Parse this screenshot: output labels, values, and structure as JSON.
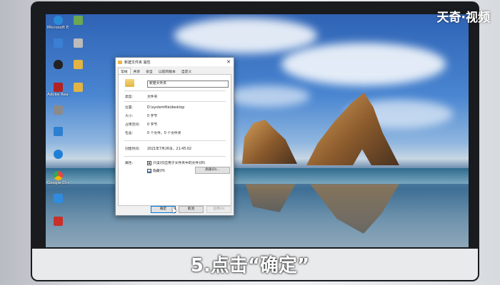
{
  "watermark": "天奇·视频",
  "caption": "5.点击“确定”",
  "desktop_icons": [
    {
      "label": "Microsoft Edge",
      "icon": "edge-icon",
      "color": "#2a8ad8"
    },
    {
      "label": "",
      "icon": "file-icon",
      "color": "#6ba84f"
    },
    {
      "label": "",
      "icon": "app-icon",
      "color": "#3b7fd4"
    },
    {
      "label": "",
      "icon": "app-icon",
      "color": "#bbbbbb"
    },
    {
      "label": "",
      "icon": "penguin-icon",
      "color": "#222222"
    },
    {
      "label": "",
      "icon": "folder-icon",
      "color": "#e3b443"
    },
    {
      "label": "",
      "icon": "app-icon",
      "color": "#3c73c7"
    },
    {
      "label": "",
      "icon": "app-icon",
      "color": "#d04a3a"
    },
    {
      "label": "Adobe Reader",
      "icon": "pdf-icon",
      "color": "#b22222"
    },
    {
      "label": "",
      "icon": "folder-icon",
      "color": "#e3b443"
    },
    {
      "label": "",
      "icon": "app-icon",
      "color": "#8a8a8a"
    },
    {
      "label": "",
      "icon": "app-icon",
      "color": "#2c7fd1"
    },
    {
      "label": "",
      "icon": "app-icon",
      "color": "#1f7fd8"
    },
    {
      "label": "Google Chrome",
      "icon": "chrome-icon",
      "color": "#e8453c"
    },
    {
      "label": "",
      "icon": "app-icon",
      "color": "#2f8ce0"
    },
    {
      "label": "",
      "icon": "app-icon",
      "color": "#c8312a"
    }
  ],
  "dialog": {
    "title": "新建文件夹 属性",
    "tabs": [
      "常规",
      "共享",
      "安全",
      "以前的版本",
      "自定义"
    ],
    "active_tab": 0,
    "name_value": "新建文件夹",
    "fields": [
      {
        "key": "类型:",
        "value": "文件夹"
      },
      {
        "key": "位置:",
        "value": "D:\\systemfile\\desktop"
      },
      {
        "key": "大小:",
        "value": "0 字节"
      },
      {
        "key": "占用空间:",
        "value": "0 字节"
      },
      {
        "key": "包含:",
        "value": "0 个文件，0 个文件夹"
      }
    ],
    "created_key": "创建时间:",
    "created_value": "2021年7月26日，21:45:02",
    "attributes_key": "属性:",
    "readonly_label": "只读(仅应用于文件夹中的文件)(R)",
    "hidden_label": "隐藏(H)",
    "advanced_label": "高级(D)...",
    "ok_label": "确定",
    "cancel_label": "取消",
    "apply_label": "应用(A)"
  }
}
